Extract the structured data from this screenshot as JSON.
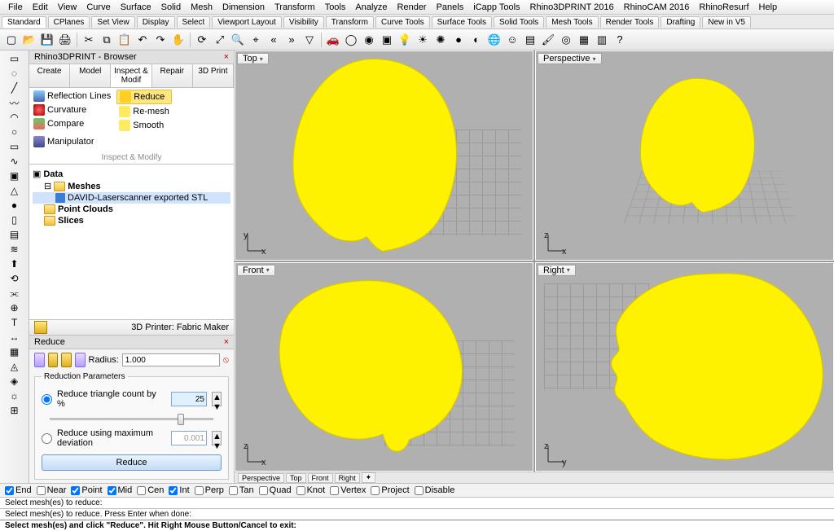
{
  "menu": [
    "File",
    "Edit",
    "View",
    "Curve",
    "Surface",
    "Solid",
    "Mesh",
    "Dimension",
    "Transform",
    "Tools",
    "Analyze",
    "Render",
    "Panels",
    "iCapp Tools",
    "Rhino3DPRINT 2016",
    "RhinoCAM 2016",
    "RhinoResurf",
    "Help"
  ],
  "tabs": [
    "Standard",
    "CPlanes",
    "Set View",
    "Display",
    "Select",
    "Viewport Layout",
    "Visibility",
    "Transform",
    "Curve Tools",
    "Surface Tools",
    "Solid Tools",
    "Mesh Tools",
    "Render Tools",
    "Drafting",
    "New in V5"
  ],
  "active_tab": "Standard",
  "toolbar_icons": [
    "new",
    "open",
    "save",
    "print",
    "cut",
    "copy",
    "paste",
    "undo",
    "redo",
    "pan",
    "rotate",
    "zoom-extents",
    "zoom-window",
    "zoom-sel",
    "history-back",
    "history-fwd",
    "filter",
    "car",
    "circle-a",
    "circle-b",
    "box",
    "lightbulb",
    "sun-a",
    "sun-b",
    "sphere-a",
    "sphere-b",
    "globe",
    "smiley",
    "gradient",
    "paint",
    "target",
    "blue",
    "calendar",
    "help"
  ],
  "left_tools": [
    "pointer",
    "lasso",
    "line",
    "polyline",
    "arc",
    "circle",
    "rect",
    "curve",
    "box",
    "cone",
    "sphere",
    "cylinder",
    "surface",
    "loft",
    "extrude",
    "revolve",
    "pipe",
    "boolean",
    "text",
    "dim",
    "hatch",
    "mesh",
    "analyze",
    "render",
    "uv"
  ],
  "browser": {
    "title": "Rhino3DPRINT - Browser",
    "tabs": [
      "Create",
      "Model",
      "Inspect & Modif",
      "Repair",
      "3D Print"
    ],
    "active": "Inspect & Modif",
    "ribbon": {
      "reflection": "Reflection Lines",
      "curvature": "Curvature",
      "compare": "Compare",
      "reduce": "Reduce",
      "remesh": "Re-mesh",
      "smooth": "Smooth",
      "manipulator": "Manipulator",
      "footer": "Inspect & Modify"
    },
    "tree": {
      "root": "Data",
      "meshes": "Meshes",
      "mesh_item": "DAVID-Laserscanner exported STL",
      "pointclouds": "Point Clouds",
      "slices": "Slices"
    },
    "printer_label": "3D Printer: Fabric Maker"
  },
  "reduce": {
    "title": "Reduce",
    "radius_label": "Radius:",
    "radius_value": "1.000",
    "group_title": "Reduction Parameters",
    "opt1_label": "Reduce triangle count by %",
    "opt1_value": "25",
    "opt2_label": "Reduce using maximum deviation",
    "opt2_value": "0.001",
    "button": "Reduce"
  },
  "viewports": {
    "top": "Top",
    "perspective": "Perspective",
    "front": "Front",
    "right": "Right",
    "axis_top": {
      "v": "y",
      "h": "x"
    },
    "axis_persp": {
      "v": "z",
      "h": "x"
    },
    "axis_front": {
      "v": "z",
      "h": "x"
    },
    "axis_right": {
      "v": "z",
      "h": "y"
    }
  },
  "vp_bottom_tabs": [
    "Perspective",
    "Top",
    "Front",
    "Right"
  ],
  "checks": [
    {
      "label": "End",
      "on": true
    },
    {
      "label": "Near",
      "on": false
    },
    {
      "label": "Point",
      "on": true
    },
    {
      "label": "Mid",
      "on": true
    },
    {
      "label": "Cen",
      "on": false
    },
    {
      "label": "Int",
      "on": true
    },
    {
      "label": "Perp",
      "on": false
    },
    {
      "label": "Tan",
      "on": false
    },
    {
      "label": "Quad",
      "on": false
    },
    {
      "label": "Knot",
      "on": false
    },
    {
      "label": "Vertex",
      "on": false
    },
    {
      "label": "Project",
      "on": false
    },
    {
      "label": "Disable",
      "on": false
    }
  ],
  "cmd1": "Select mesh(es) to reduce:",
  "cmd2": "Select mesh(es) to reduce. Press Enter when done:",
  "cmd3": "Select mesh(es) and click \"Reduce\". Hit Right Mouse Button/Cancel to exit:"
}
